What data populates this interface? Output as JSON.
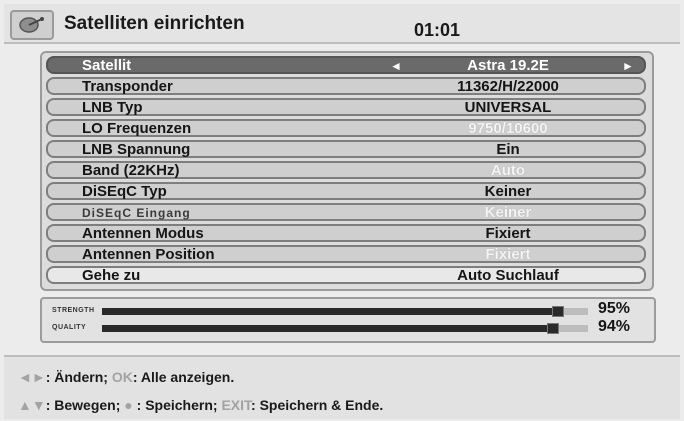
{
  "header": {
    "logo_icon": "satellite-dish-icon",
    "title": "Satelliten einrichten",
    "clock": "01:01"
  },
  "settings": [
    {
      "label": "Satellit",
      "value": "Astra 19.2E",
      "selected": true
    },
    {
      "label": "Transponder",
      "value": "11362/H/22000"
    },
    {
      "label": "LNB Typ",
      "value": "UNIVERSAL"
    },
    {
      "label": "LO Frequenzen",
      "value": "9750/10600",
      "faded": true
    },
    {
      "label": "LNB Spannung",
      "value": "Ein"
    },
    {
      "label": "Band (22KHz)",
      "value": "Auto",
      "faded": true
    },
    {
      "label": "DiSEqC Typ",
      "value": "Keiner"
    },
    {
      "label": "DiSEqC Eingang",
      "value": "Keiner",
      "faded": true,
      "dim": true
    },
    {
      "label": "Antennen Modus",
      "value": "Fixiert"
    },
    {
      "label": "Antennen Position",
      "value": "Fixiert",
      "faded": true
    },
    {
      "label": "Gehe zu",
      "value": "Auto Suchlauf"
    }
  ],
  "arrows": {
    "left": "◄",
    "right": "►"
  },
  "meters": {
    "strength": {
      "label": "STRENGTH",
      "percent": 95,
      "text": "95%"
    },
    "quality": {
      "label": "QUALITY",
      "percent": 94,
      "text": "94%"
    }
  },
  "help": {
    "line1": {
      "keys": "◄►",
      "sep1": ": Ändern; ",
      "ok": "OK",
      "sep2": ": Alle anzeigen."
    },
    "line2": {
      "keys": "▲▼",
      "sep1": ": Bewegen; ",
      "dot": "●",
      "sep2": " : Speichern; ",
      "exit": "EXIT",
      "sep3": ": Speichern & Ende."
    }
  }
}
